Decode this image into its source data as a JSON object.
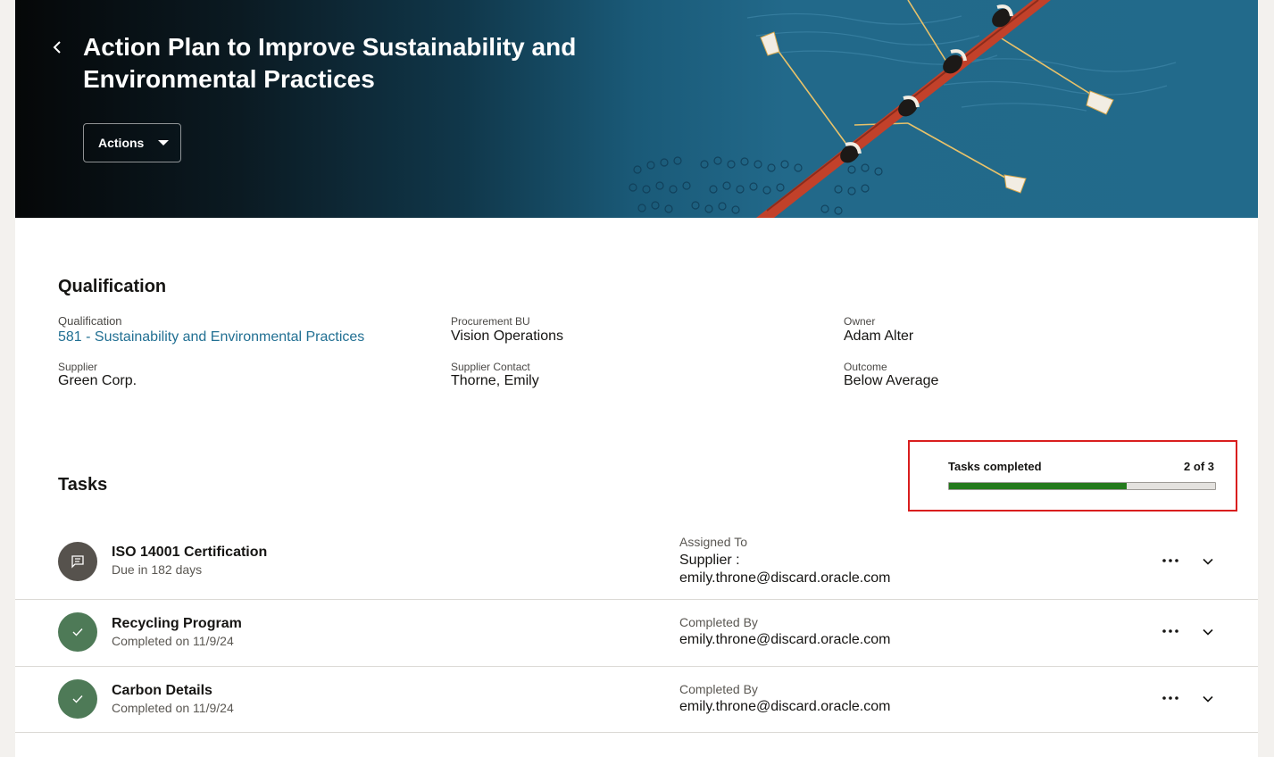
{
  "header": {
    "title": "Action Plan to Improve Sustainability and Environmental Practices",
    "actions_label": "Actions"
  },
  "qualification": {
    "heading": "Qualification",
    "fields": {
      "qualification_label": "Qualification",
      "qualification_value": "581 - Sustainability and Environmental Practices",
      "procurement_bu_label": "Procurement BU",
      "procurement_bu_value": "Vision Operations",
      "owner_label": "Owner",
      "owner_value": "Adam Alter",
      "supplier_label": "Supplier",
      "supplier_value": "Green Corp.",
      "supplier_contact_label": "Supplier Contact",
      "supplier_contact_value": "Thorne, Emily",
      "outcome_label": "Outcome",
      "outcome_value": "Below Average"
    }
  },
  "tasks": {
    "heading": "Tasks",
    "progress": {
      "label": "Tasks completed",
      "count_text": "2 of 3",
      "completed": 2,
      "total": 3,
      "fill_color": "#237a1c"
    },
    "items": [
      {
        "name": "ISO 14001 Certification",
        "subtitle": "Due in 182 days",
        "status_icon": "chat-icon",
        "col_label": "Assigned To",
        "col_value_line1": "Supplier :",
        "col_value_line2": "emily.throne@discard.oracle.com"
      },
      {
        "name": "Recycling Program",
        "subtitle": "Completed on 11/9/24",
        "status_icon": "checkmark-icon",
        "col_label": "Completed By",
        "col_value_line1": "emily.throne@discard.oracle.com"
      },
      {
        "name": "Carbon Details",
        "subtitle": "Completed on 11/9/24",
        "status_icon": "checkmark-icon",
        "col_label": "Completed By",
        "col_value_line1": "emily.throne@discard.oracle.com"
      }
    ]
  },
  "colors": {
    "link": "#227093",
    "completed_icon": "#4e7a57",
    "pending_icon": "#56524d",
    "boat": "#c2412a",
    "highlight_border": "#d91e1e"
  }
}
